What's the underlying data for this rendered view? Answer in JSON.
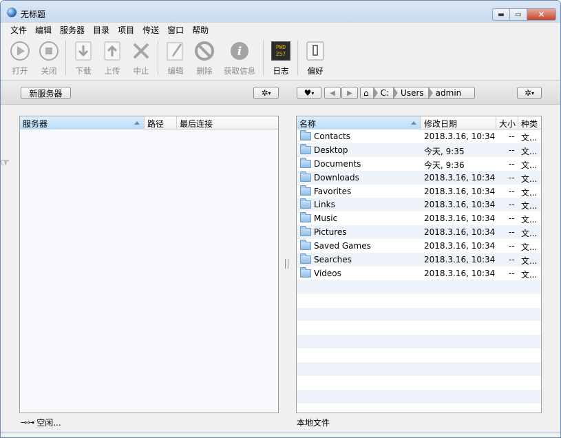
{
  "window": {
    "title": "无标题"
  },
  "menu": [
    "文件",
    "编辑",
    "服务器",
    "目录",
    "项目",
    "传送",
    "窗口",
    "帮助"
  ],
  "toolbar": {
    "open": "打开",
    "close": "关闭",
    "download": "下载",
    "upload": "上传",
    "stop": "中止",
    "edit": "编辑",
    "delete": "删除",
    "info": "获取信息",
    "log": "日志",
    "prefs": "偏好",
    "log_icon_text": "PWD\n257"
  },
  "strip": {
    "new_server": "新服务器",
    "path": [
      "C:",
      "Users",
      "admin"
    ]
  },
  "left_panel": {
    "columns": [
      "服务器",
      "路径",
      "最后连接"
    ]
  },
  "right_panel": {
    "columns": [
      "名称",
      "修改日期",
      "大小",
      "种类"
    ],
    "rows": [
      {
        "name": "Contacts",
        "date": "2018.3.16, 10:34",
        "size": "--",
        "kind": "文..."
      },
      {
        "name": "Desktop",
        "date": "今天, 9:35",
        "size": "--",
        "kind": "文..."
      },
      {
        "name": "Documents",
        "date": "今天, 9:36",
        "size": "--",
        "kind": "文..."
      },
      {
        "name": "Downloads",
        "date": "2018.3.16, 10:34",
        "size": "--",
        "kind": "文..."
      },
      {
        "name": "Favorites",
        "date": "2018.3.16, 10:34",
        "size": "--",
        "kind": "文..."
      },
      {
        "name": "Links",
        "date": "2018.3.16, 10:34",
        "size": "--",
        "kind": "文..."
      },
      {
        "name": "Music",
        "date": "2018.3.16, 10:34",
        "size": "--",
        "kind": "文..."
      },
      {
        "name": "Pictures",
        "date": "2018.3.16, 10:34",
        "size": "--",
        "kind": "文..."
      },
      {
        "name": "Saved Games",
        "date": "2018.3.16, 10:34",
        "size": "--",
        "kind": "文..."
      },
      {
        "name": "Searches",
        "date": "2018.3.16, 10:34",
        "size": "--",
        "kind": "文..."
      },
      {
        "name": "Videos",
        "date": "2018.3.16, 10:34",
        "size": "--",
        "kind": "文..."
      }
    ]
  },
  "status": {
    "left": "空闲...",
    "right": "本地文件"
  }
}
